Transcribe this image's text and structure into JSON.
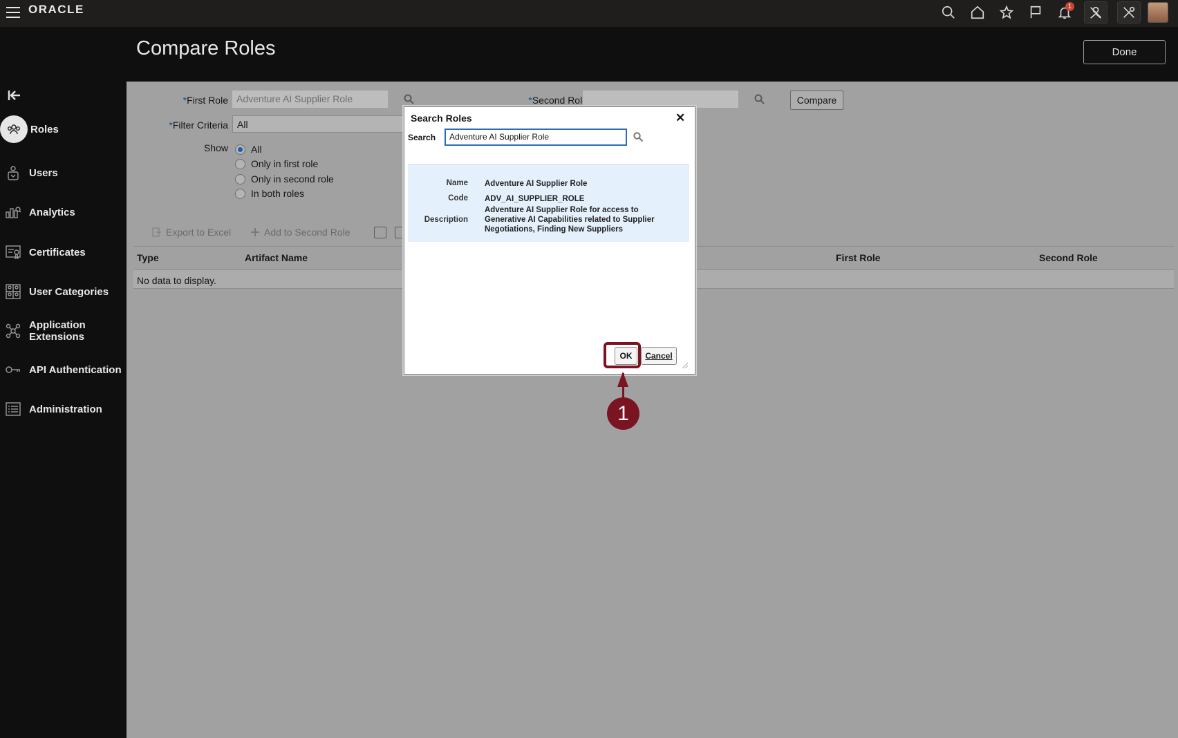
{
  "topbar": {
    "logo": "ORACLE",
    "notification_count": "1",
    "icons": [
      "search-icon",
      "home-icon",
      "star-icon",
      "flag-icon",
      "bell-icon",
      "person-pin-icon",
      "settings-tool-icon",
      "avatar"
    ]
  },
  "header": {
    "title": "Compare Roles",
    "done_label": "Done"
  },
  "sidebar": {
    "items": [
      {
        "label": "Roles",
        "icon": "roles-icon",
        "active": true
      },
      {
        "label": "Users",
        "icon": "users-icon"
      },
      {
        "label": "Analytics",
        "icon": "analytics-icon"
      },
      {
        "label": "Certificates",
        "icon": "certificates-icon"
      },
      {
        "label": "User Categories",
        "icon": "user-categories-icon"
      },
      {
        "label": "Application\nExtensions",
        "icon": "application-extensions-icon"
      },
      {
        "label": "API Authentication",
        "icon": "key-icon"
      },
      {
        "label": "Administration",
        "icon": "administration-icon"
      }
    ]
  },
  "form": {
    "required_mark": "*",
    "first_role_label": "First Role",
    "first_role_value": "Adventure AI Supplier Role",
    "second_role_label": "Second Role",
    "second_role_value": "",
    "compare_label": "Compare",
    "filter_criteria_label": "Filter Criteria",
    "filter_criteria_value": "All",
    "show_label": "Show",
    "show_options": [
      "All",
      "Only in first role",
      "Only in second role",
      "In both roles"
    ],
    "show_selected": "All"
  },
  "toolbar": {
    "export_label": "Export to Excel",
    "add_second_label": "Add to Second Role"
  },
  "table": {
    "columns": [
      "Type",
      "Artifact Name",
      "First Role",
      "Second Role"
    ],
    "empty_text": "No data to display."
  },
  "dialog": {
    "title": "Search Roles",
    "close_glyph": "✕",
    "search_label": "Search",
    "search_value": "Adventure AI Supplier Role",
    "result": {
      "name_label": "Name",
      "name": "Adventure AI Supplier Role",
      "code_label": "Code",
      "code": "ADV_AI_SUPPLIER_ROLE",
      "description_label": "Description",
      "description": "Adventure AI Supplier Role for access to Generative AI Capabilities related to Supplier Negotiations, Finding New Suppliers"
    },
    "ok_label": "OK",
    "cancel_label": "Cancel"
  },
  "annotation": {
    "step_number": "1",
    "color": "#7a1420"
  }
}
